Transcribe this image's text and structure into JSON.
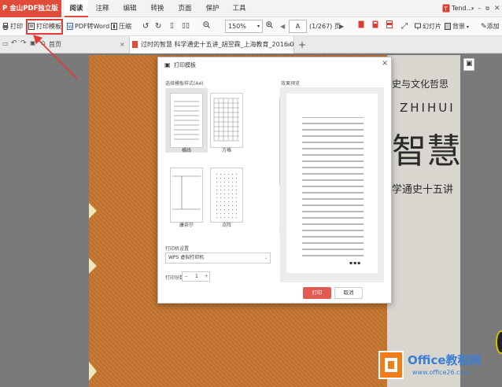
{
  "app": {
    "title": "金山PDF独立版",
    "user": "Tend...",
    "logo_icon": "pdf-logo-icon"
  },
  "menu": {
    "items": [
      "阅读",
      "注释",
      "编辑",
      "转换",
      "页面",
      "保护",
      "工具"
    ],
    "active": "阅读"
  },
  "toolbar": {
    "print": "打印",
    "print_template": "打印模板",
    "pdf_to_word": "PDF转Word",
    "compress": "压缩",
    "zoom": "150%",
    "page_input": "A",
    "page_count": "(1/267) 页",
    "slideshow": "幻灯片",
    "background": "背景",
    "add": "添加"
  },
  "tabs": {
    "home": "首页",
    "document": "过时的智慧 科学通史十五讲_胡翌霖_上海教育_2016.07-1.pdf"
  },
  "cover": {
    "line1": "术史与文化哲思",
    "line2": "ZHIHUI",
    "line3": "智慧",
    "line4": "学通史十五讲"
  },
  "dialog": {
    "title": "打印模板",
    "section_template": "选择模板样式(A4)",
    "section_preview": "效果预览",
    "templates": [
      {
        "name": "横线",
        "selected": true
      },
      {
        "name": "方格",
        "selected": false
      },
      {
        "name": "康奈尔",
        "selected": false
      },
      {
        "name": "点阵",
        "selected": false
      }
    ],
    "printer_label": "打印机设置",
    "printer_value": "WPS 虚拟打印机",
    "copies_label": "打印份数",
    "copies_value": "1",
    "print_button": "打印",
    "cancel_button": "取消",
    "accent": "#e05a52"
  },
  "watermark": {
    "brand": "Office教程网",
    "url": "www.office26.com",
    "accent": "#f07d1a",
    "text_color": "#3a7fd6"
  },
  "colors": {
    "brand_red": "#e04b3a",
    "book_brown": "#c5762f",
    "highlight": "#e53935"
  }
}
